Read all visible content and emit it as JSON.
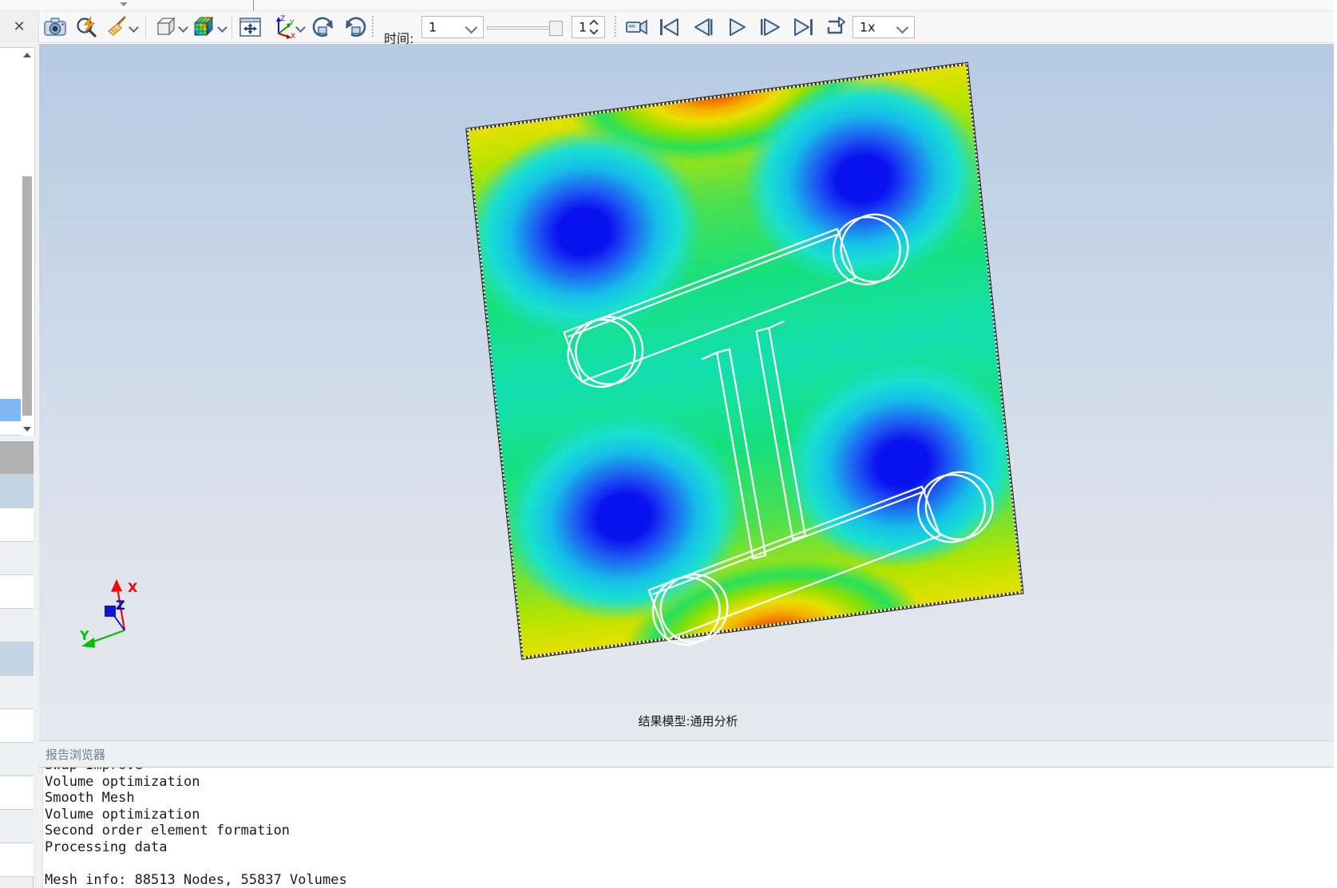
{
  "window": {
    "close_label": "✕"
  },
  "toolbar": {
    "buttons": [
      {
        "name": "screenshot-icon",
        "title": "截图"
      },
      {
        "name": "zoom-lightning-icon",
        "title": "快速缩放"
      },
      {
        "name": "broom-clean-icon",
        "title": "清除"
      },
      {
        "name": "box-shape-icon",
        "title": "形状"
      },
      {
        "name": "contour-cube-icon",
        "title": "云图"
      },
      {
        "name": "pan-fit-icon",
        "title": "适配视图"
      },
      {
        "name": "axis-triad-icon",
        "title": "视角"
      },
      {
        "name": "rotate-cw-icon",
        "title": "顺时针旋转"
      },
      {
        "name": "rotate-ccw-icon",
        "title": "逆时针旋转"
      }
    ],
    "time_label": "时间:",
    "time_combo_value": "1",
    "time_spin_value": "1",
    "slider_position_percent": 100,
    "playback": [
      {
        "name": "record-camera-icon",
        "title": "录制"
      },
      {
        "name": "skip-first-icon",
        "title": "第一帧"
      },
      {
        "name": "step-back-icon",
        "title": "上一帧"
      },
      {
        "name": "play-icon",
        "title": "播放"
      },
      {
        "name": "step-forward-icon",
        "title": "下一帧"
      },
      {
        "name": "skip-last-icon",
        "title": "最后一帧"
      },
      {
        "name": "loop-icon",
        "title": "循环"
      }
    ],
    "speed_value": "1x"
  },
  "left_panel": {
    "scroll_thumb_present": true,
    "selected_item_highlight": true,
    "grid_rows": 12
  },
  "viewport": {
    "caption": "结果模型:通用分析",
    "background_top_color": "#b5cae3",
    "background_bottom_color": "#e6e8ed",
    "triad": {
      "x_label": "X",
      "y_label": "Y",
      "z_label": "Z",
      "x_color": "#ff0000",
      "y_color": "#00c000",
      "z_color": "#0000cc"
    }
  },
  "chart_data": {
    "type": "heatmap",
    "title": "结果模型:通用分析",
    "description": "Rectangular plate FEA contour (rainbow colormap) with four circular bolt-hole features and two internal slot features",
    "colormap": [
      "#0b12f0",
      "#1e5df2",
      "#15bfe8",
      "#13dfb0",
      "#16e07d",
      "#4ae050",
      "#b6e400",
      "#e8e000",
      "#f5b000",
      "#e85000",
      "#d61a00"
    ],
    "features": [
      {
        "name": "hole-top-left",
        "x_pct": 21,
        "y_pct": 22,
        "value_level": "min"
      },
      {
        "name": "hole-top-right",
        "x_pct": 77,
        "y_pct": 19,
        "value_level": "min"
      },
      {
        "name": "hole-bottom-left",
        "x_pct": 23,
        "y_pct": 76,
        "value_level": "min"
      },
      {
        "name": "hole-bottom-right",
        "x_pct": 79,
        "y_pct": 73,
        "value_level": "min"
      },
      {
        "name": "hotspot-top-edge",
        "x_pct": 50,
        "y_pct": 0,
        "value_level": "max"
      },
      {
        "name": "hotspot-bottom-edge",
        "x_pct": 50,
        "y_pct": 100,
        "value_level": "max"
      }
    ],
    "grid": false,
    "legend": "none"
  },
  "report": {
    "tab_label": "报告浏览器"
  },
  "console": {
    "lines": [
      "Swap Improve",
      "Volume optimization",
      "Smooth Mesh",
      "Volume optimization",
      "Second order element formation",
      "Processing data",
      "",
      "Mesh info: 88513 Nodes, 55837 Volumes"
    ]
  }
}
